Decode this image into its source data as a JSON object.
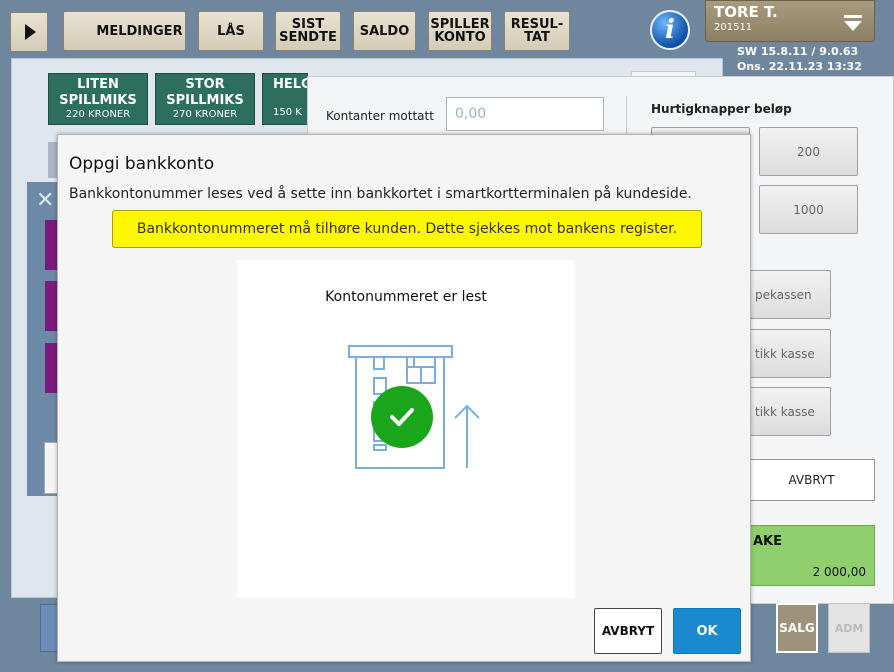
{
  "toolbar": {
    "buttons": [
      {
        "label": "MELDINGER"
      },
      {
        "label": "LÅS"
      },
      {
        "label": "SIST\nSENDTE"
      },
      {
        "label": "SALDO"
      },
      {
        "label": "SPILLER\nKONTO"
      },
      {
        "label": "RESUL-\nTAT"
      }
    ],
    "info_icon": "info-icon",
    "user": {
      "name": "TORE T.",
      "id": "201511",
      "menu_icon": "menu-dropdown-icon"
    },
    "version_line1": "SW 15.8.11 / 9.0.63",
    "version_line2": "Ons. 22.11.23 13:32"
  },
  "games": [
    {
      "title": "LITEN\nSPILLMIKS",
      "price": "220 KRONER"
    },
    {
      "title": "STOR\nSPILLMIKS",
      "price": "270 KRONER"
    },
    {
      "title": "HELG",
      "price": "150 K"
    }
  ],
  "payment": {
    "cash_label": "Kontanter mottatt",
    "cash_placeholder": "0,00",
    "quick_label": "Hurtigknapper beløp",
    "quick_amounts": [
      "",
      "200",
      "",
      "1000"
    ],
    "actions": [
      "pekassen",
      "tikk kasse",
      "tikk kasse"
    ],
    "cancel": "AVBRYT",
    "total_title": "AKE",
    "total_value": "2 000,00"
  },
  "bottom_nav": {
    "salg": "SALG",
    "adm": "ADM"
  },
  "dialog": {
    "title": "Oppgi bankkonto",
    "description": "Bankkontonummer leses ved å sette inn bankkortet i smartkortterminalen på kundeside.",
    "warning": "Bankkontonummeret må tilhøre kunden. Dette sjekkes mot bankens register.",
    "status": "Kontonummeret er lest",
    "cancel": "AVBRYT",
    "ok": "OK"
  },
  "colors": {
    "game_button": "#2e6e5e",
    "warning_bg": "#fff700",
    "ok_button": "#1a8ad0",
    "success": "#1aa61a",
    "total_bg": "#8fcf6e"
  }
}
